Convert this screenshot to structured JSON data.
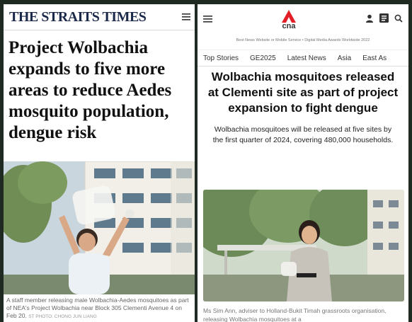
{
  "left": {
    "logo": "THE STRAITS TIMES",
    "headline": "Project Wolbachia expands to five more areas to reduce Aedes mosquito population, dengue risk",
    "caption": "A staff member releasing male Wolbachia-Aedes mosquitoes as part of NEA's Project Wolbachia near Block 305 Clementi Avenue 4 on Feb 20.",
    "credit": "ST PHOTO: CHONG JUN LIANG"
  },
  "right": {
    "logo": "cna",
    "award": "Best News Website or Mobile Service • Digital Media Awards Worldwide 2022",
    "tabs": [
      "Top Stories",
      "GE2025",
      "Latest News",
      "Asia",
      "East As"
    ],
    "headline": "Wolbachia mosquitoes released at Clementi site as part of project expansion to fight dengue",
    "subheadline": "Wolbachia mosquitoes will be released at five sites by the first quarter of 2024, covering 480,000 households.",
    "caption": "Ms Sim Ann, adviser to Holland-Bukit Timah grassroots organisation, releasing Wolbachia mosquitoes at a"
  },
  "icons": {
    "menu_left": "menu-icon",
    "menu_right": "menu-icon",
    "account": "user-icon",
    "edition": "grid-icon",
    "search": "search-icon"
  },
  "colors": {
    "st_navy": "#1b2a4a",
    "cna_red": "#e21f26"
  }
}
